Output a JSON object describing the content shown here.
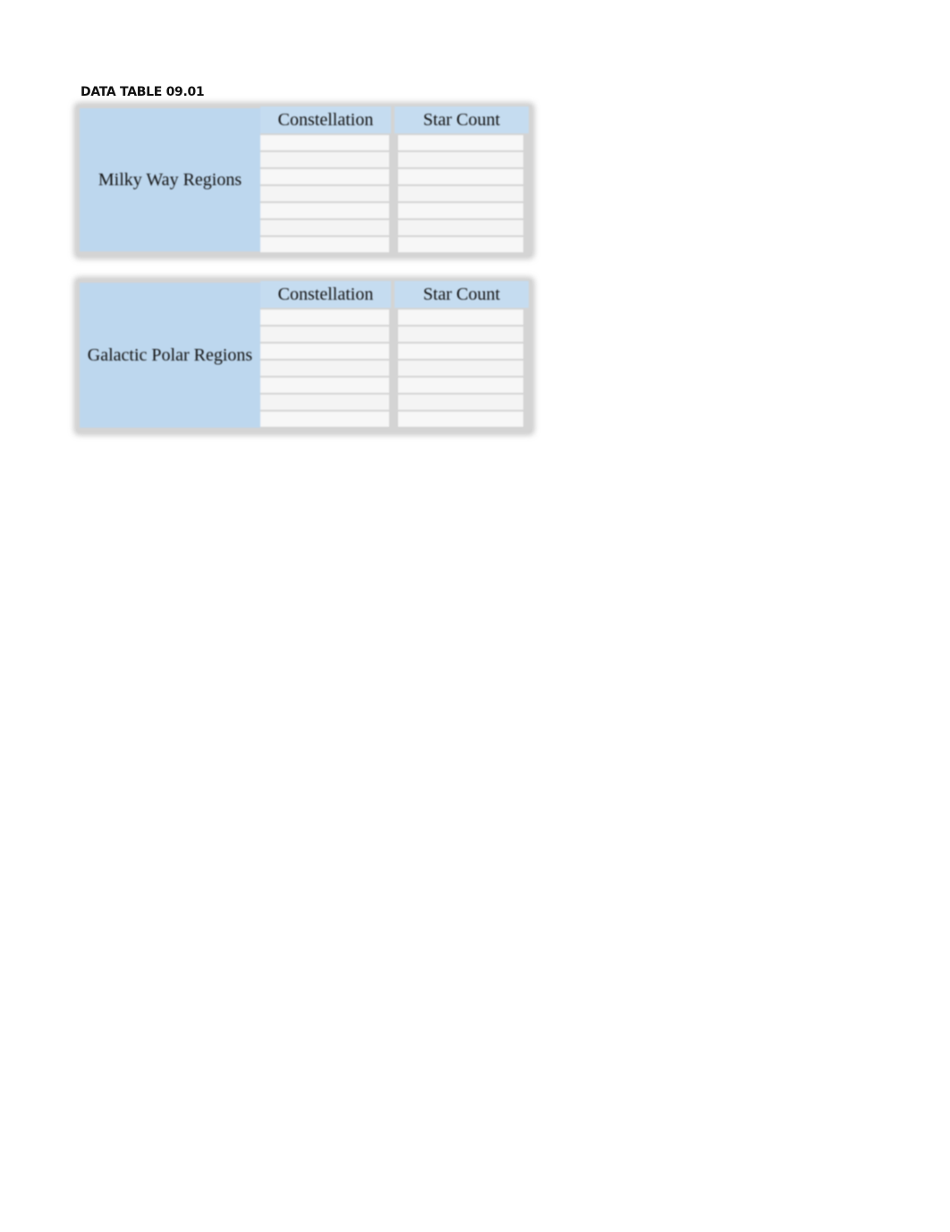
{
  "caption": "DATA TABLE 09.01",
  "tables": [
    {
      "region_label": "Milky Way Regions",
      "columns": [
        "Constellation",
        "Star Count"
      ],
      "rows": [
        [
          "",
          ""
        ],
        [
          "",
          ""
        ],
        [
          "",
          ""
        ],
        [
          "",
          ""
        ],
        [
          "",
          ""
        ],
        [
          "",
          ""
        ],
        [
          "",
          ""
        ]
      ]
    },
    {
      "region_label": "Galactic Polar Regions",
      "columns": [
        "Constellation",
        "Star Count"
      ],
      "rows": [
        [
          "",
          ""
        ],
        [
          "",
          ""
        ],
        [
          "",
          ""
        ],
        [
          "",
          ""
        ],
        [
          "",
          ""
        ],
        [
          "",
          ""
        ],
        [
          "",
          ""
        ]
      ]
    }
  ],
  "colors": {
    "header_fill": "#bdd7ee",
    "cell_fill": "#f4f4f4",
    "grid": "#d4d4d4"
  }
}
